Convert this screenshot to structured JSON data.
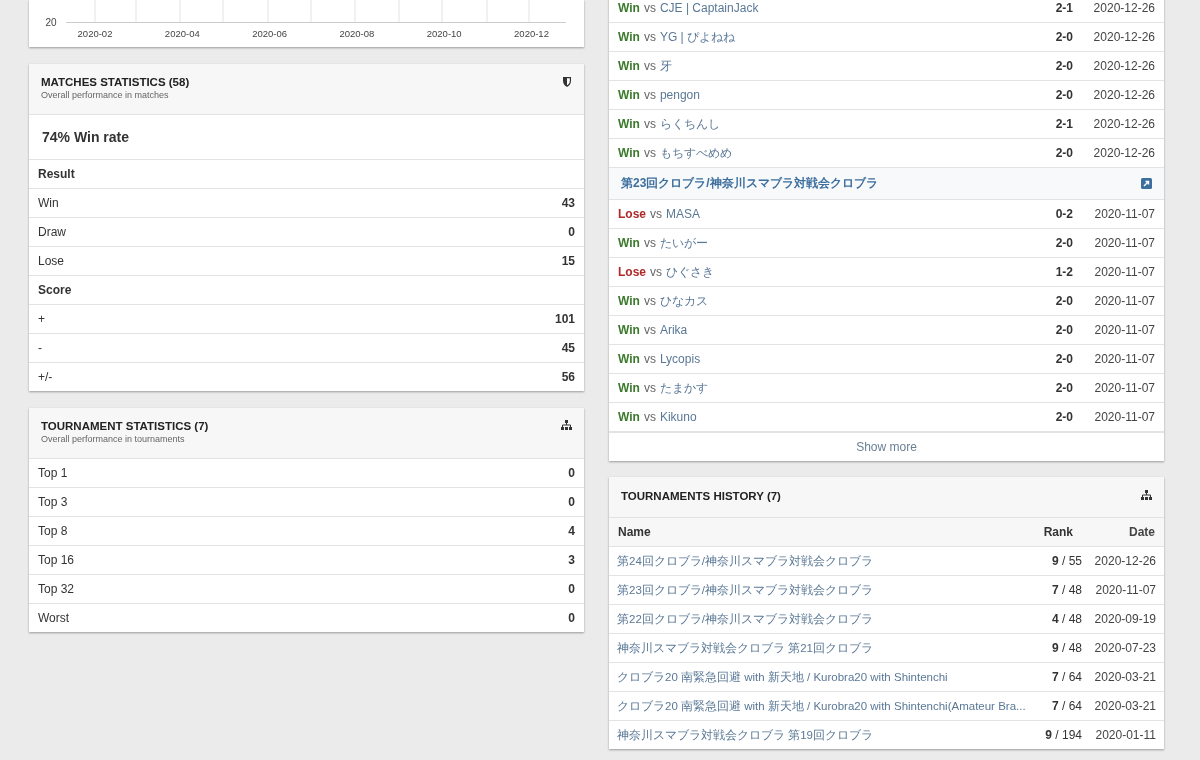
{
  "chart": {
    "y_tick": "20",
    "x_ticks": [
      "2020-02",
      "2020-04",
      "2020-06",
      "2020-08",
      "2020-10",
      "2020-12"
    ]
  },
  "matches_statistics": {
    "title": "MATCHES STATISTICS (58)",
    "subtitle": "Overall performance in matches",
    "win_rate": "74% Win rate",
    "sections": [
      {
        "heading": "Result",
        "rows": [
          {
            "label": "Win",
            "value": "43"
          },
          {
            "label": "Draw",
            "value": "0"
          },
          {
            "label": "Lose",
            "value": "15"
          }
        ]
      },
      {
        "heading": "Score",
        "rows": [
          {
            "label": "+",
            "value": "101"
          },
          {
            "label": "-",
            "value": "45"
          },
          {
            "label": "+/-",
            "value": "56"
          }
        ]
      }
    ]
  },
  "tournament_statistics": {
    "title": "TOURNAMENT STATISTICS (7)",
    "subtitle": "Overall performance in tournaments",
    "rows": [
      {
        "label": "Top 1",
        "value": "0"
      },
      {
        "label": "Top 3",
        "value": "0"
      },
      {
        "label": "Top 8",
        "value": "4"
      },
      {
        "label": "Top 16",
        "value": "3"
      },
      {
        "label": "Top 32",
        "value": "0"
      },
      {
        "label": "Worst",
        "value": "0"
      }
    ]
  },
  "matches": {
    "items": [
      {
        "kind": "match",
        "won": true,
        "result": "Win",
        "vs": "vs",
        "opponent": "CJE | CaptainJack",
        "score": "2-1",
        "date": "2020-12-26"
      },
      {
        "kind": "match",
        "won": true,
        "result": "Win",
        "vs": "vs",
        "opponent": "YG | ぴよねね",
        "score": "2-0",
        "date": "2020-12-26"
      },
      {
        "kind": "match",
        "won": true,
        "result": "Win",
        "vs": "vs",
        "opponent": "牙",
        "score": "2-0",
        "date": "2020-12-26"
      },
      {
        "kind": "match",
        "won": true,
        "result": "Win",
        "vs": "vs",
        "opponent": "pengon",
        "score": "2-0",
        "date": "2020-12-26"
      },
      {
        "kind": "match",
        "won": true,
        "result": "Win",
        "vs": "vs",
        "opponent": "らくちんし",
        "score": "2-1",
        "date": "2020-12-26"
      },
      {
        "kind": "match",
        "won": true,
        "result": "Win",
        "vs": "vs",
        "opponent": "もちすべめめ",
        "score": "2-0",
        "date": "2020-12-26"
      },
      {
        "kind": "tournament",
        "name": "第23回クロブラ/神奈川スマブラ対戦会クロブラ"
      },
      {
        "kind": "match",
        "won": false,
        "result": "Lose",
        "vs": "vs",
        "opponent": "MASA",
        "score": "0-2",
        "date": "2020-11-07"
      },
      {
        "kind": "match",
        "won": true,
        "result": "Win",
        "vs": "vs",
        "opponent": "たいがー",
        "score": "2-0",
        "date": "2020-11-07"
      },
      {
        "kind": "match",
        "won": false,
        "result": "Lose",
        "vs": "vs",
        "opponent": "ひぐさき",
        "score": "1-2",
        "date": "2020-11-07"
      },
      {
        "kind": "match",
        "won": true,
        "result": "Win",
        "vs": "vs",
        "opponent": "ひなカス",
        "score": "2-0",
        "date": "2020-11-07"
      },
      {
        "kind": "match",
        "won": true,
        "result": "Win",
        "vs": "vs",
        "opponent": "Arika",
        "score": "2-0",
        "date": "2020-11-07"
      },
      {
        "kind": "match",
        "won": true,
        "result": "Win",
        "vs": "vs",
        "opponent": "Lycopis",
        "score": "2-0",
        "date": "2020-11-07"
      },
      {
        "kind": "match",
        "won": true,
        "result": "Win",
        "vs": "vs",
        "opponent": "たまかす",
        "score": "2-0",
        "date": "2020-11-07"
      },
      {
        "kind": "match",
        "won": true,
        "result": "Win",
        "vs": "vs",
        "opponent": "Kikuno",
        "score": "2-0",
        "date": "2020-11-07"
      }
    ],
    "show_more": "Show more"
  },
  "tournaments_history": {
    "title": "TOURNAMENTS HISTORY (7)",
    "columns": [
      "Name",
      "Rank",
      "Date"
    ],
    "rows": [
      {
        "name": "第24回クロブラ/神奈川スマブラ対戦会クロブラ",
        "rank": "**9** / 55",
        "date": "2020-12-26"
      },
      {
        "name": "第23回クロブラ/神奈川スマブラ対戦会クロブラ",
        "rank": "**7** / 48",
        "date": "2020-11-07"
      },
      {
        "name": "第22回クロブラ/神奈川スマブラ対戦会クロブラ",
        "rank": "**4** / 48",
        "date": "2020-09-19"
      },
      {
        "name": "神奈川スマブラ対戦会クロブラ 第21回クロブラ",
        "rank": "**9** / 48",
        "date": "2020-07-23"
      },
      {
        "name": "クロブラ20 南緊急回避 with 新天地 / Kurobra20 with Shintenchi",
        "rank": "**7** / 64",
        "date": "2020-03-21"
      },
      {
        "name": "クロブラ20 南緊急回避 with 新天地 / Kurobra20 with Shintenchi(Amateur Bra...",
        "rank": "**7** / 64",
        "date": "2020-03-21"
      },
      {
        "name": "神奈川スマブラ対戦会クロブラ 第19回クロブラ",
        "rank": "**9** / 194",
        "date": "2020-01-11"
      }
    ]
  }
}
